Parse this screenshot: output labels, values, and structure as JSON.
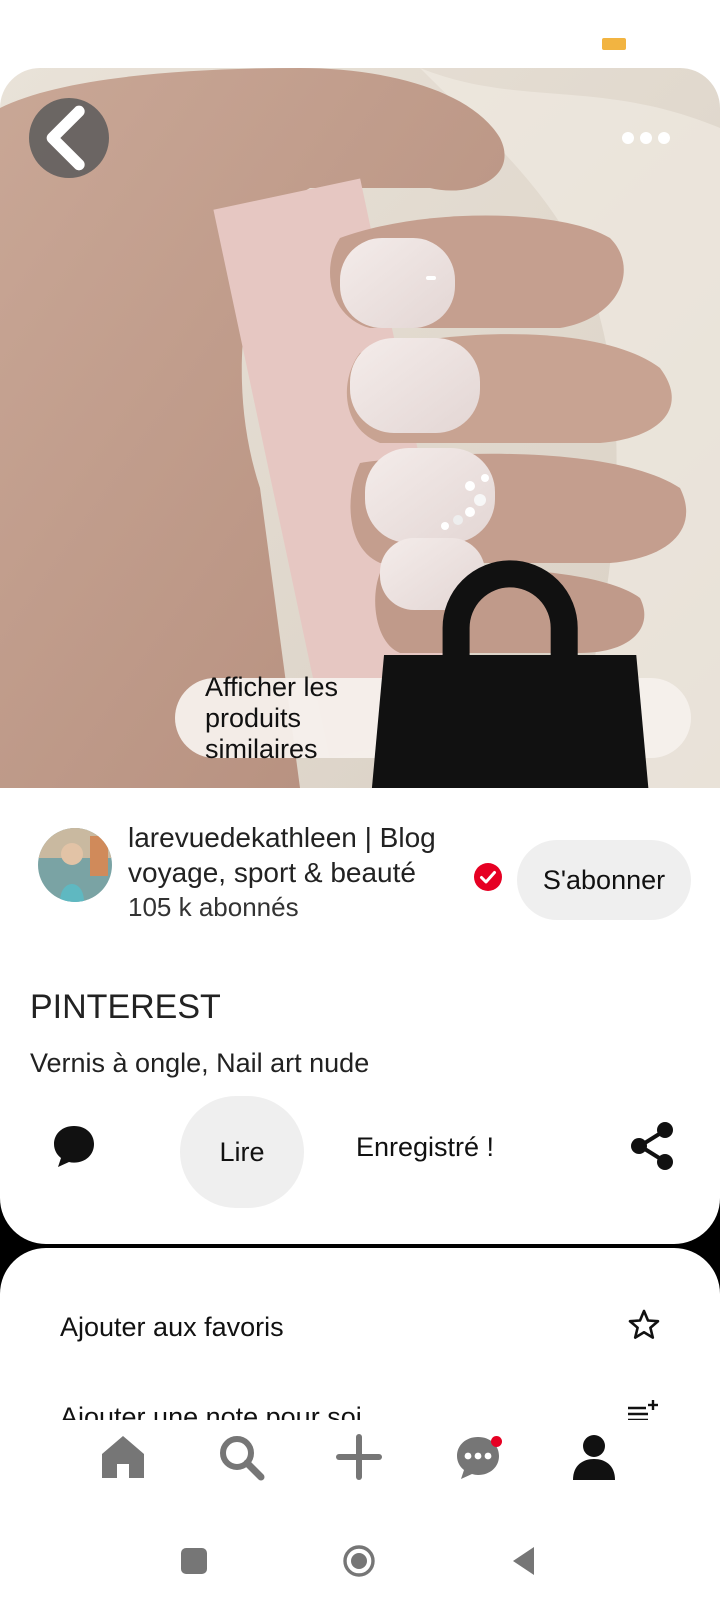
{
  "colors": {
    "status_battery": "#f2b441",
    "verified": "#e60023",
    "notification_dot": "#e60023",
    "button_gray": "#efefef",
    "icon_dark": "#111111",
    "nav_inactive": "#767676"
  },
  "image": {
    "back_icon": "chevron-left-icon",
    "more_icon": "more-horizontal-icon",
    "similar_products": {
      "label": "Afficher les produits similaires",
      "icon": "shopping-bag-icon"
    }
  },
  "creator": {
    "name": "larevuedekathleen | Blog voyage, sport & beauté",
    "followers": "105 k abonnés",
    "verified_icon": "verified-badge-icon",
    "subscribe_label": "S'abonner"
  },
  "pin": {
    "title": "PINTEREST",
    "description": "Vernis à ongle, Nail art nude"
  },
  "actions": {
    "comment_icon": "comment-icon",
    "read_label": "Lire",
    "saved_label": "Enregistré !",
    "share_icon": "share-icon"
  },
  "sheet": {
    "items": [
      {
        "label": "Ajouter aux favoris",
        "icon": "star-icon"
      },
      {
        "label": "Ajouter une note pour soi",
        "icon": "add-note-icon"
      }
    ]
  },
  "bottom_nav": [
    {
      "name": "home",
      "icon": "home-icon"
    },
    {
      "name": "search",
      "icon": "search-icon"
    },
    {
      "name": "create",
      "icon": "plus-icon"
    },
    {
      "name": "messages",
      "icon": "messages-icon",
      "has_notification": true
    },
    {
      "name": "profile",
      "icon": "profile-icon",
      "active": true
    }
  ],
  "system_nav": [
    "recents-square-icon",
    "home-circle-icon",
    "back-triangle-icon"
  ]
}
